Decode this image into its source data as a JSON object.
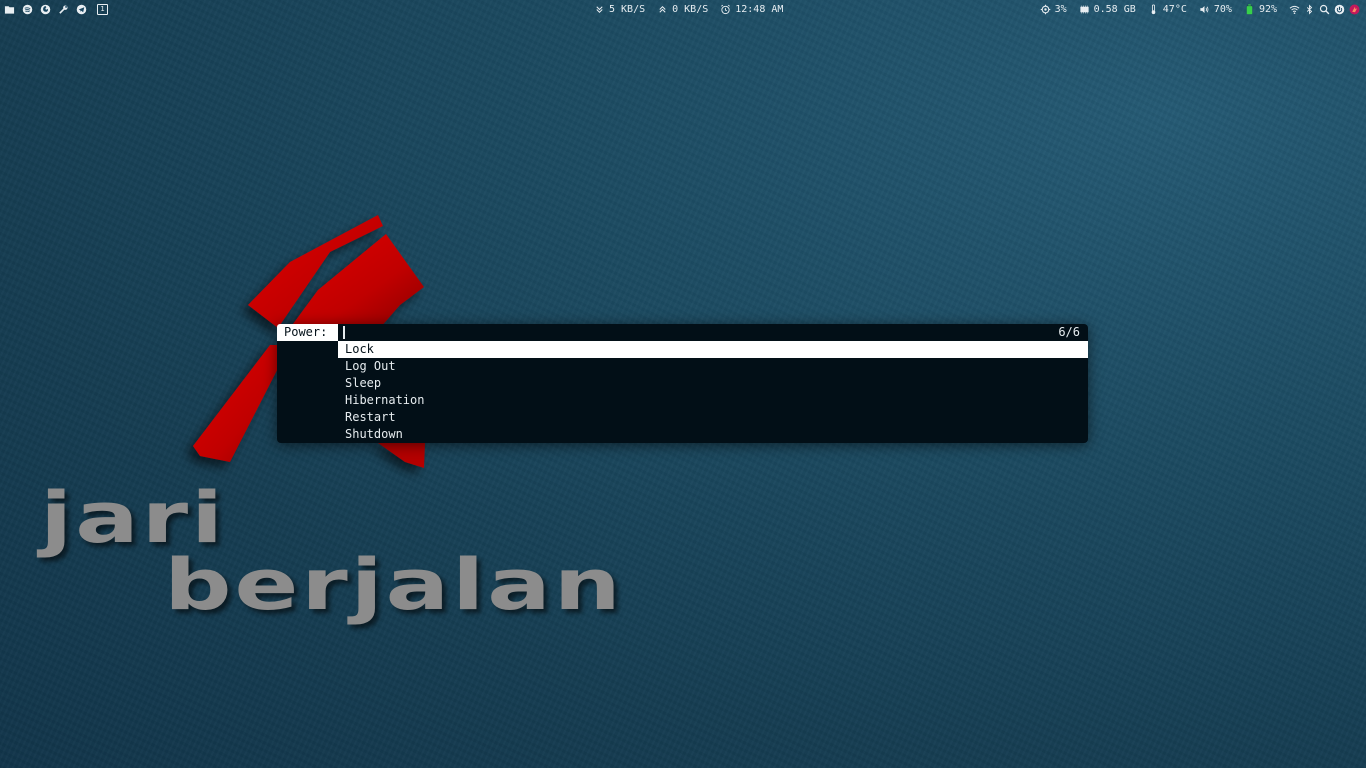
{
  "topbar": {
    "left_icons": [
      "folder-icon",
      "spotify-icon",
      "firefox-icon",
      "tools-icon",
      "telegram-icon"
    ],
    "workspace": "1",
    "net_down": "5 KB/S",
    "net_up": "0 KB/S",
    "clock": "12:48 AM",
    "cpu": "3%",
    "memory": "0.58 GB",
    "temperature": "47°C",
    "volume": "70%",
    "battery": "92%",
    "battery_level": 0.92,
    "right_icons": [
      "wifi-icon",
      "bluetooth-icon",
      "search-icon",
      "power-icon",
      "app-icon"
    ]
  },
  "menu": {
    "prompt": "Power:",
    "input_value": "",
    "count": "6/6",
    "items": [
      {
        "label": "Lock"
      },
      {
        "label": "Log Out"
      },
      {
        "label": "Sleep"
      },
      {
        "label": "Hibernation"
      },
      {
        "label": "Restart"
      },
      {
        "label": "Shutdown"
      }
    ],
    "selected_index": 0
  },
  "wallpaper": {
    "line1": "jari",
    "line2": "berjalan",
    "logo_color": "#cc0000"
  }
}
